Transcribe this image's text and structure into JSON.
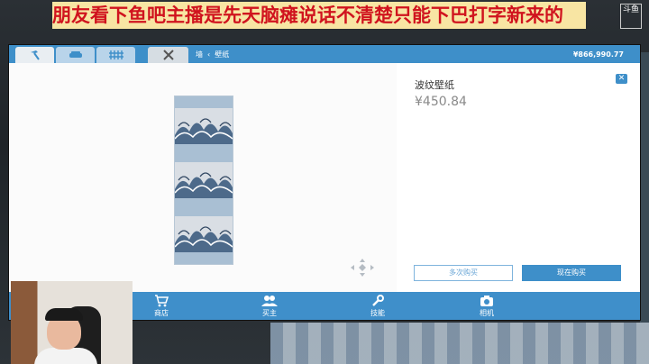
{
  "stream": {
    "banner_text": "朋友看下鱼吧主播是先天脑瘫说话不清楚只能下巴打字新来的",
    "logo_text": "斗鱼"
  },
  "window": {
    "tabs": [
      {
        "icon": "hammer-icon"
      },
      {
        "icon": "sofa-icon"
      },
      {
        "icon": "fence-icon"
      },
      {
        "icon": "tools-icon"
      }
    ],
    "breadcrumb": {
      "category": "墙",
      "sub": "壁纸"
    },
    "money": "¥866,990.77"
  },
  "item": {
    "name": "波纹壁纸",
    "price": "¥450.84",
    "close_label": "✕",
    "buy_multiple_label": "多次购买",
    "buy_now_label": "现在购买"
  },
  "bottom_nav": [
    {
      "label": "商店",
      "icon": "cart-icon"
    },
    {
      "label": "买主",
      "icon": "people-icon"
    },
    {
      "label": "技能",
      "icon": "wrench-icon"
    },
    {
      "label": "相机",
      "icon": "camera-icon"
    }
  ],
  "colors": {
    "accent": "#3e8fc9",
    "banner_bg": "#f8e5a3",
    "banner_text": "#d0131e"
  }
}
